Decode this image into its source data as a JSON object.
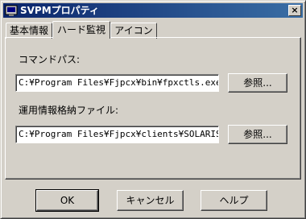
{
  "window": {
    "title": "SVPMプロパティ",
    "close_glyph": "×"
  },
  "tabs": [
    {
      "label": "基本情報",
      "active": false
    },
    {
      "label": "ハード監視",
      "active": true
    },
    {
      "label": "アイコン",
      "active": false
    }
  ],
  "form": {
    "command_path_label": "コマンドパス:",
    "command_path_value": "C:¥Program Files¥Fjpcx¥bin¥fpxctls.exe",
    "command_browse": "参照...",
    "info_file_label": "運用情報格納ファイル:",
    "info_file_value": "C:¥Program Files¥Fjpcx¥clients¥SOLARIS¥ja",
    "info_browse": "参照..."
  },
  "buttons": {
    "ok": "OK",
    "cancel": "キャンセル",
    "help": "ヘルプ"
  }
}
